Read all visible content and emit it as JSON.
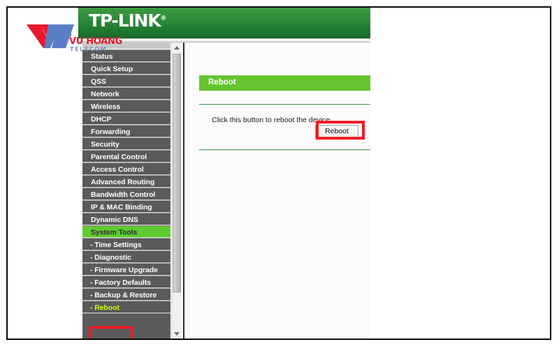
{
  "watermark": {
    "mark_icon": "vh-monogram-icon",
    "primary_text": "VU HOANG",
    "secondary_text": "TELECOM",
    "red": "#e8192c",
    "blue": "#5b7fc4"
  },
  "brand": {
    "name": "TP-LINK",
    "registered_mark": "®",
    "banner_color": "#2e8b3a"
  },
  "sidebar": {
    "items": [
      {
        "label": "Status",
        "level": "top",
        "state": "normal"
      },
      {
        "label": "Quick Setup",
        "level": "top",
        "state": "normal"
      },
      {
        "label": "QSS",
        "level": "top",
        "state": "normal"
      },
      {
        "label": "Network",
        "level": "top",
        "state": "normal"
      },
      {
        "label": "Wireless",
        "level": "top",
        "state": "normal"
      },
      {
        "label": "DHCP",
        "level": "top",
        "state": "normal"
      },
      {
        "label": "Forwarding",
        "level": "top",
        "state": "normal"
      },
      {
        "label": "Security",
        "level": "top",
        "state": "normal"
      },
      {
        "label": "Parental Control",
        "level": "top",
        "state": "normal"
      },
      {
        "label": "Access Control",
        "level": "top",
        "state": "normal"
      },
      {
        "label": "Advanced Routing",
        "level": "top",
        "state": "normal"
      },
      {
        "label": "Bandwidth Control",
        "level": "top",
        "state": "normal"
      },
      {
        "label": "IP & MAC Binding",
        "level": "top",
        "state": "normal"
      },
      {
        "label": "Dynamic DNS",
        "level": "top",
        "state": "normal"
      },
      {
        "label": "System Tools",
        "level": "top",
        "state": "active"
      },
      {
        "label": "- Time Settings",
        "level": "sub",
        "state": "normal"
      },
      {
        "label": "- Diagnostic",
        "level": "sub",
        "state": "normal"
      },
      {
        "label": "- Firmware Upgrade",
        "level": "sub",
        "state": "normal"
      },
      {
        "label": "- Factory Defaults",
        "level": "sub",
        "state": "normal"
      },
      {
        "label": "- Backup & Restore",
        "level": "sub",
        "state": "normal"
      },
      {
        "label": "- Reboot",
        "level": "sub",
        "state": "current"
      }
    ],
    "active_color": "#5fcb32",
    "current_text_color": "#ccff00"
  },
  "scrollbar": {
    "up_arrow_icon": "triangle-up-icon",
    "down_arrow_icon": "triangle-down-icon",
    "thumb_label": "scrollbar-thumb"
  },
  "content": {
    "page_title": "Reboot",
    "instruction": "Click this button to reboot the device.",
    "reboot_button_label": "Reboot",
    "header_color": "#66c430",
    "rule_color": "#3f8f52"
  },
  "annotations": {
    "color": "#ee1c25",
    "boxes": [
      {
        "name": "reboot-button-highlight"
      },
      {
        "name": "reboot-menu-highlight"
      }
    ]
  }
}
